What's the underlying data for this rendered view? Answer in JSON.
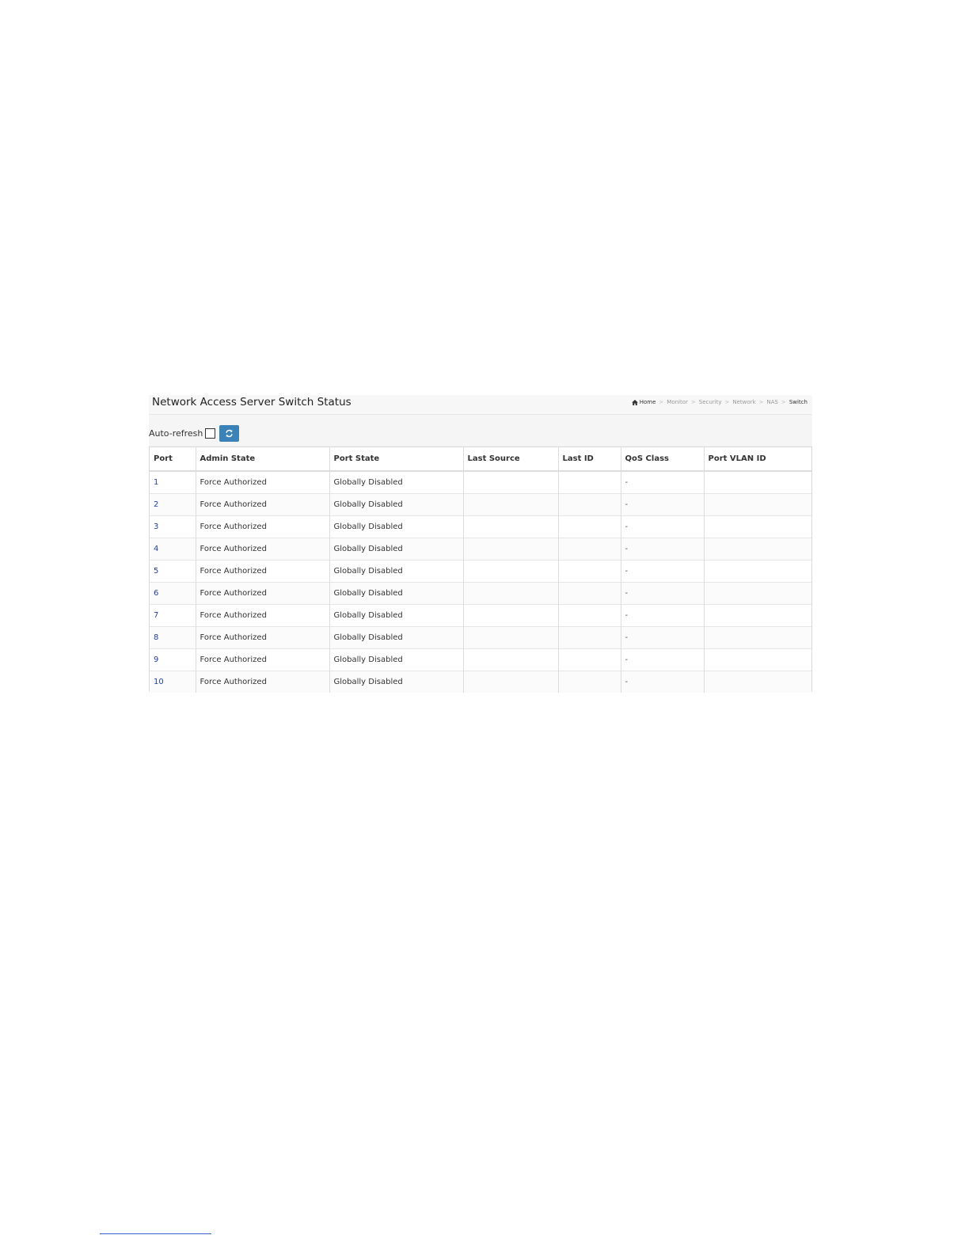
{
  "header": {
    "title": "Network Access Server Switch Status",
    "breadcrumb": [
      "Home",
      "Monitor",
      "Security",
      "Network",
      "NAS",
      "Switch"
    ],
    "breadcrumb_separator": ">"
  },
  "toolbar": {
    "auto_refresh_label": "Auto-refresh",
    "auto_refresh_checked": false,
    "refresh_icon": "refresh-icon"
  },
  "table": {
    "columns": [
      "Port",
      "Admin State",
      "Port State",
      "Last Source",
      "Last ID",
      "QoS Class",
      "Port VLAN ID"
    ],
    "rows": [
      {
        "port": "1",
        "admin_state": "Force Authorized",
        "port_state": "Globally Disabled",
        "last_source": "",
        "last_id": "",
        "qos_class": "-",
        "port_vlan_id": ""
      },
      {
        "port": "2",
        "admin_state": "Force Authorized",
        "port_state": "Globally Disabled",
        "last_source": "",
        "last_id": "",
        "qos_class": "-",
        "port_vlan_id": ""
      },
      {
        "port": "3",
        "admin_state": "Force Authorized",
        "port_state": "Globally Disabled",
        "last_source": "",
        "last_id": "",
        "qos_class": "-",
        "port_vlan_id": ""
      },
      {
        "port": "4",
        "admin_state": "Force Authorized",
        "port_state": "Globally Disabled",
        "last_source": "",
        "last_id": "",
        "qos_class": "-",
        "port_vlan_id": ""
      },
      {
        "port": "5",
        "admin_state": "Force Authorized",
        "port_state": "Globally Disabled",
        "last_source": "",
        "last_id": "",
        "qos_class": "-",
        "port_vlan_id": ""
      },
      {
        "port": "6",
        "admin_state": "Force Authorized",
        "port_state": "Globally Disabled",
        "last_source": "",
        "last_id": "",
        "qos_class": "-",
        "port_vlan_id": ""
      },
      {
        "port": "7",
        "admin_state": "Force Authorized",
        "port_state": "Globally Disabled",
        "last_source": "",
        "last_id": "",
        "qos_class": "-",
        "port_vlan_id": ""
      },
      {
        "port": "8",
        "admin_state": "Force Authorized",
        "port_state": "Globally Disabled",
        "last_source": "",
        "last_id": "",
        "qos_class": "-",
        "port_vlan_id": ""
      },
      {
        "port": "9",
        "admin_state": "Force Authorized",
        "port_state": "Globally Disabled",
        "last_source": "",
        "last_id": "",
        "qos_class": "-",
        "port_vlan_id": ""
      },
      {
        "port": "10",
        "admin_state": "Force Authorized",
        "port_state": "Globally Disabled",
        "last_source": "",
        "last_id": "",
        "qos_class": "-",
        "port_vlan_id": ""
      }
    ]
  },
  "colors": {
    "accent": "#3a82b8",
    "link": "#2340a8"
  }
}
